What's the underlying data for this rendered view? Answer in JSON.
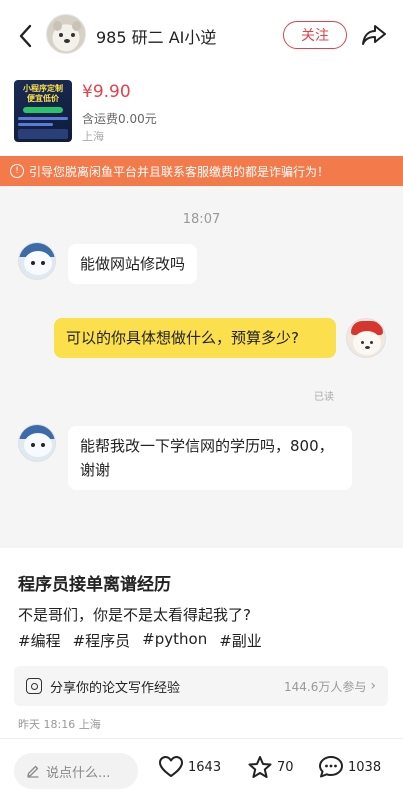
{
  "header": {
    "username": "985 研二 AI小逆",
    "follow_label": "关注"
  },
  "product": {
    "thumb_text": "小程序定制 便宜低价",
    "price": "¥9.90",
    "shipping": "含运费0.00元",
    "location": "上海"
  },
  "warning": {
    "text": "引导您脱离闲鱼平台并且联系客服缴费的都是诈骗行为！"
  },
  "chat": {
    "timestamp": "18:07",
    "messages": [
      {
        "direction": "in",
        "text": "能做网站修改吗"
      },
      {
        "direction": "out",
        "text": "可以的你具体想做什么，预算多少?",
        "status": "已读"
      },
      {
        "direction": "in",
        "text": "能帮我改一下学信网的学历吗，800，谢谢"
      }
    ]
  },
  "post": {
    "title": "程序员接单离谱经历",
    "body": "不是哥们，你是不是太看得起我了?",
    "tags": [
      "#编程",
      "#程序员",
      "#python",
      "#副业"
    ],
    "topic": {
      "label": "分享你的论文写作经验",
      "count": "144.6万人参与"
    },
    "meta": "昨天 18:16 上海"
  },
  "bottom_bar": {
    "comment_placeholder": "说点什么...",
    "likes": "1643",
    "favorites": "70",
    "comments": "1038"
  },
  "colors": {
    "accent": "#e5404d",
    "warning_bg": "#f37a4a",
    "out_bubble": "#fbdf4c",
    "chat_bg": "#f5f5f5"
  }
}
